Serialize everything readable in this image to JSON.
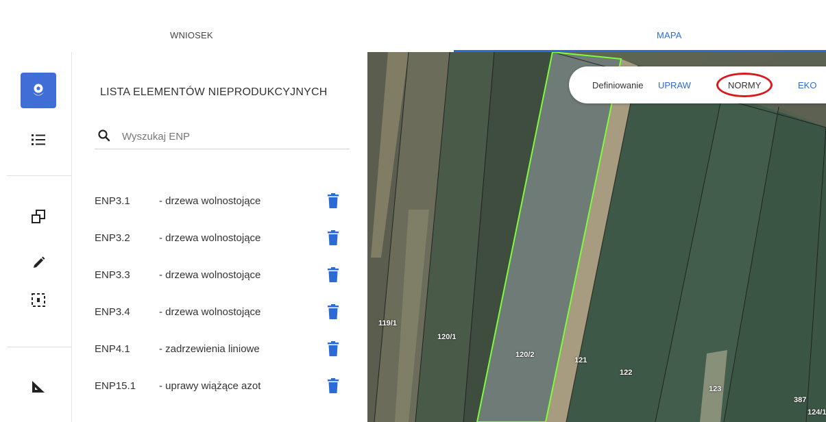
{
  "tabs": {
    "wniosek": "WNIOSEK",
    "mapa": "MAPA"
  },
  "rail": {
    "icons": [
      "flower-icon",
      "list-icon",
      "copy-icon",
      "pencil-icon",
      "selection-icon",
      "ruler-icon"
    ],
    "accent": "#3f6fd6"
  },
  "panel": {
    "title": "LISTA ELEMENTÓW NIEPRODUKCYJNYCH",
    "search": {
      "placeholder": "Wyszukaj ENP",
      "value": ""
    },
    "items": [
      {
        "code": "ENP3.1",
        "desc": "- drzewa wolnostojące"
      },
      {
        "code": "ENP3.2",
        "desc": "- drzewa wolnostojące"
      },
      {
        "code": "ENP3.3",
        "desc": "- drzewa wolnostojące"
      },
      {
        "code": "ENP3.4",
        "desc": "- drzewa wolnostojące"
      },
      {
        "code": "ENP4.1",
        "desc": "- zadrzewienia liniowe"
      },
      {
        "code": "ENP15.1",
        "desc": "- uprawy wiążące azot"
      }
    ]
  },
  "map": {
    "definiowanie": "Definiowanie",
    "buttons": {
      "upraw": "UPRAW",
      "normy": "NORMY",
      "eko": "EKO"
    },
    "parcels": [
      "119/1",
      "120/1",
      "120/2",
      "121",
      "122",
      "123",
      "387",
      "124/1"
    ],
    "selected_parcel_color": "#7cff3a",
    "highlight_color": "#d9191e"
  },
  "colors": {
    "accent": "#2c6bd6",
    "delete_icon": "#2c6bd6"
  }
}
